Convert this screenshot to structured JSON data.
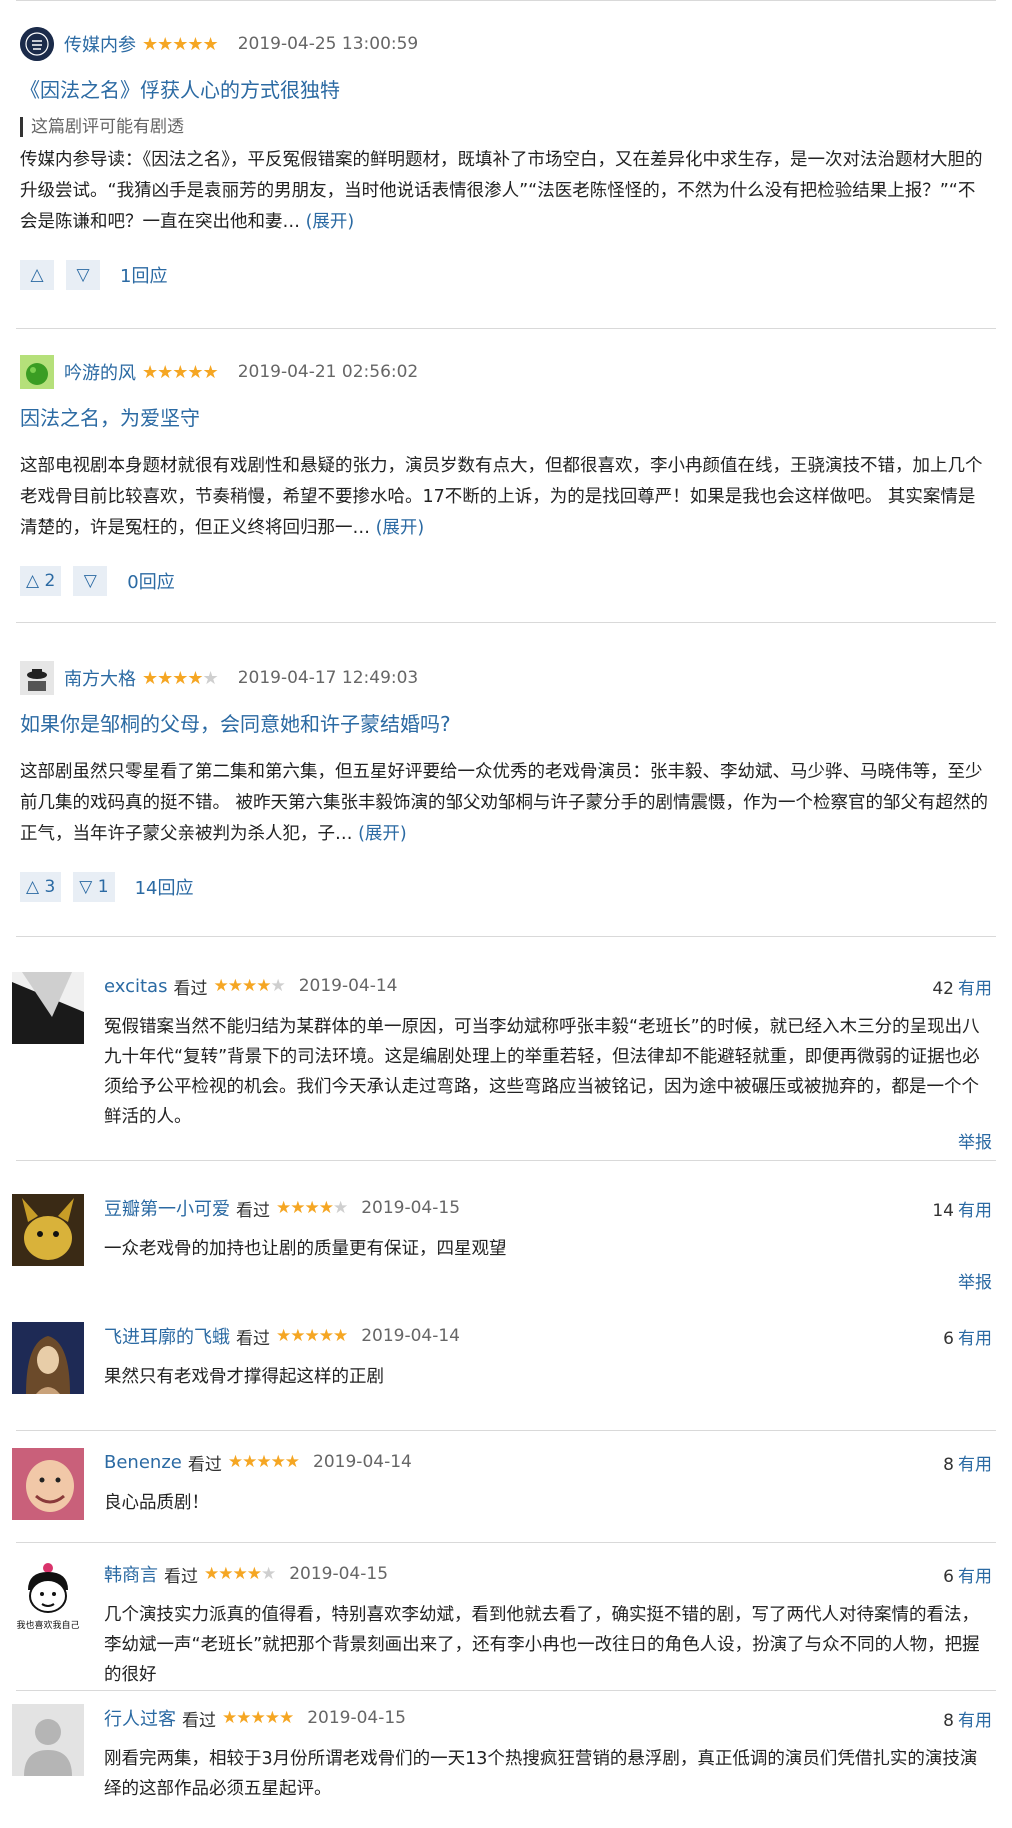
{
  "reviews": [
    {
      "author": "传媒内参",
      "stars": "★★★★★",
      "stars_off": "",
      "time": "2019-04-25 13:00:59",
      "title": "《因法之名》俘获人心的方式很独特",
      "spoiler": "这篇剧评可能有剧透",
      "body": "传媒内参导读：《因法之名》，平反冤假错案的鲜明题材，既填补了市场空白，又在差异化中求生存，是一次对法治题材大胆的升级尝试。“我猜凶手是袁丽芳的男朋友，当时他说话表情很渗人”“法医老陈怪怪的，不然为什么没有把检验结果上报？”“不会是陈谦和吧？一直在突出他和妻… ",
      "expand": "(展开)",
      "up": "△",
      "down": "▽",
      "replies": "1回应"
    },
    {
      "author": "吟游的风",
      "stars": "★★★★★",
      "stars_off": "",
      "time": "2019-04-21 02:56:02",
      "title": "因法之名，为爱坚守",
      "body": "这部电视剧本身题材就很有戏剧性和悬疑的张力，演员岁数有点大，但都很喜欢，李小冉颜值在线，王骁演技不错，加上几个老戏骨目前比较喜欢，节奏稍慢，希望不要掺水哈。17不断的上诉，为的是找回尊严！如果是我也会这样做吧。 其实案情是清楚的，许是冤枉的，但正义终将回归那一… ",
      "expand": "(展开)",
      "up": "△ 2",
      "down": "▽",
      "replies": "0回应"
    },
    {
      "author": "南方大格",
      "stars": "★★★★",
      "stars_off": "★",
      "time": "2019-04-17 12:49:03",
      "title": "如果你是邹桐的父母，会同意她和许子蒙结婚吗?",
      "body": "这部剧虽然只零星看了第二集和第六集，但五星好评要给一众优秀的老戏骨演员：张丰毅、李幼斌、马少骅、马晓伟等，至少前几集的戏码真的挺不错。 被昨天第六集张丰毅饰演的邹父劝邹桐与许子蒙分手的剧情震慑，作为一个检察官的邹父有超然的正气，当年许子蒙父亲被判为杀人犯，子… ",
      "expand": "(展开)",
      "up": "△ 3",
      "down": "▽ 1",
      "replies": "14回应"
    }
  ],
  "comments": [
    {
      "author": "excitas",
      "seen": "看过",
      "stars": "★★★★",
      "stars_off": "★",
      "date": "2019-04-14",
      "useful_count": "42",
      "useful_label": "有用",
      "body": "冤假错案当然不能归结为某群体的单一原因，可当李幼斌称呼张丰毅“老班长”的时候，就已经入木三分的呈现出八九十年代“复转”背景下的司法环境。这是编剧处理上的举重若轻，但法律却不能避轻就重，即便再微弱的证据也必须给予公平检视的机会。我们今天承认走过弯路，这些弯路应当被铭记，因为途中被碾压或被抛弃的，都是一个个鲜活的人。",
      "report": "举报"
    },
    {
      "author": "豆瓣第一小可爱",
      "seen": "看过",
      "stars": "★★★★",
      "stars_off": "★",
      "date": "2019-04-15",
      "useful_count": "14",
      "useful_label": "有用",
      "body": "一众老戏骨的加持也让剧的质量更有保证，四星观望",
      "report": "举报"
    },
    {
      "author": "飞进耳廓的飞蛾",
      "seen": "看过",
      "stars": "★★★★★",
      "stars_off": "",
      "date": "2019-04-14",
      "useful_count": "6",
      "useful_label": "有用",
      "body": "果然只有老戏骨才撑得起这样的正剧"
    },
    {
      "author": "Benenze",
      "seen": "看过",
      "stars": "★★★★★",
      "stars_off": "",
      "date": "2019-04-14",
      "useful_count": "8",
      "useful_label": "有用",
      "body": "良心品质剧！"
    },
    {
      "author": "韩商言",
      "seen": "看过",
      "stars": "★★★★",
      "stars_off": "★",
      "date": "2019-04-15",
      "useful_count": "6",
      "useful_label": "有用",
      "body": "几个演技实力派真的值得看，特别喜欢李幼斌，看到他就去看了，确实挺不错的剧，写了两代人对待案情的看法，李幼斌一声“老班长”就把那个背景刻画出来了，还有李小冉也一改往日的角色人设，扮演了与众不同的人物，把握的很好",
      "avatar_caption": "我也喜欢我自己"
    },
    {
      "author": "行人过客",
      "seen": "看过",
      "stars": "★★★★★",
      "stars_off": "",
      "date": "2019-04-15",
      "useful_count": "8",
      "useful_label": "有用",
      "body": "刚看完两集，相较于3月份所谓老戏骨们的一天13个热搜疯狂营销的悬浮剧，真正低调的演员们凭借扎实的演技演绎的这部作品必须五星起评。"
    }
  ]
}
